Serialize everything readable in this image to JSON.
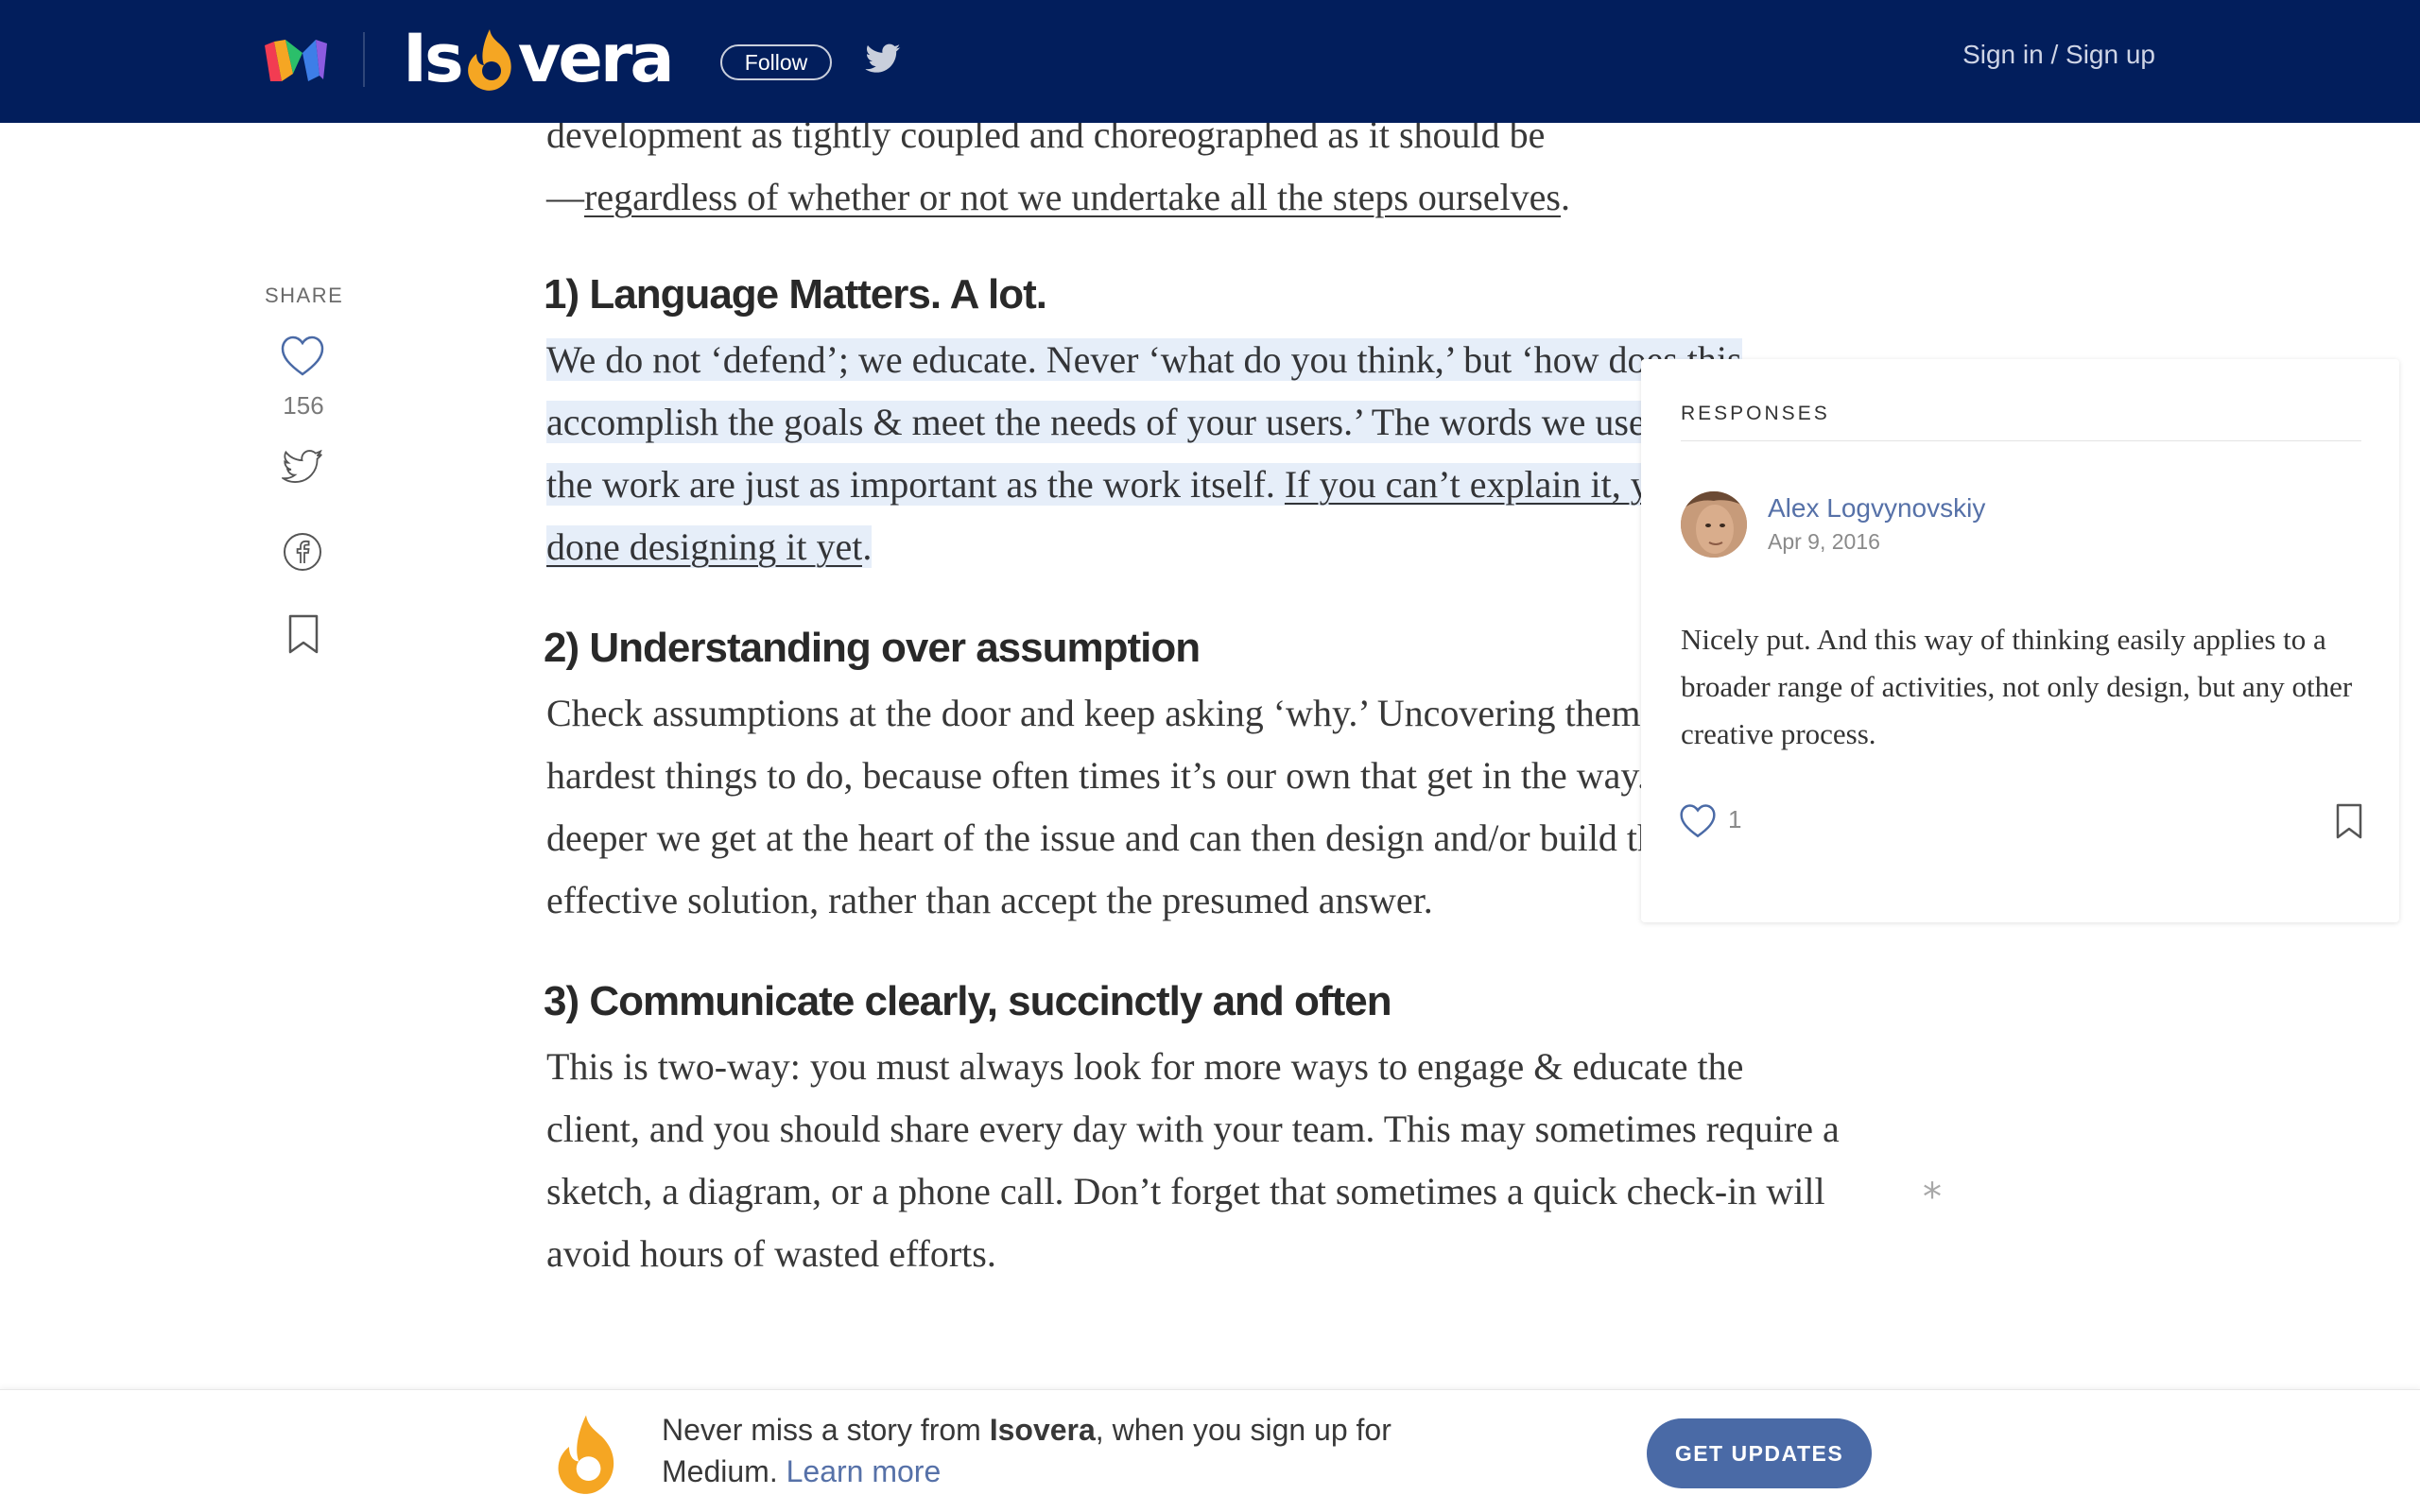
{
  "topbar": {
    "brand_prefix": "Is",
    "brand_suffix": "vera",
    "follow_label": "Follow",
    "signin_label": "Sign in / Sign up",
    "background_color": "#021e5c"
  },
  "share": {
    "label": "SHARE",
    "like_count": "156",
    "icons": [
      "heart-icon",
      "twitter-icon",
      "facebook-icon",
      "bookmark-icon"
    ]
  },
  "article": {
    "intro_line1": "development as tightly coupled and choreographed as it should be",
    "intro_dash": "—",
    "intro_link": "regardless of whether or not we undertake all the steps ourselves",
    "intro_end": ".",
    "sections": [
      {
        "heading": "1) Language Matters. A lot.",
        "body_plain": "We do not ‘defend’; we educate. Never ‘what do you think,’ but ‘how does this accomplish the goals & meet the needs of your users.’ The words we use to describe the work are just as important as the work itself. ",
        "body_link": "If you can’t explain it, you’re not done designing it yet",
        "body_end": "."
      },
      {
        "heading": "2) Understanding over assumption",
        "body": "Check assumptions at the door and keep asking ‘why.’ Uncovering them is one of the hardest things to do, because often times it’s our own that get in the way. By probing deeper we get at the heart of the issue and can then design and/or build the most effective solution, rather than accept the presumed answer."
      },
      {
        "heading": "3) Communicate clearly, succinctly and often",
        "body": "This is two-way: you must always look for more ways to engage & educate the client, and you should share every day with your team. This may sometimes require a sketch, a diagram, or a phone call. Don’t forget that sometimes a quick check-in will avoid hours of wasted efforts."
      }
    ]
  },
  "responses": {
    "title": "RESPONSES",
    "author": "Alex Logvynovskiy",
    "date": "Apr 9, 2016",
    "body": "Nicely put. And this way of thinking easily applies to a broader range of activities, not only design, but any other creative process.",
    "like_count": "1"
  },
  "star_symbol": "*",
  "banner": {
    "text_before": "Never miss a story from ",
    "publication": "Isovera",
    "text_after": ", when you sign up for Medium. ",
    "learn_more": "Learn more",
    "button_label": "GET UPDATES",
    "accent_color": "#f5a623",
    "button_color": "#4a6aa6"
  }
}
